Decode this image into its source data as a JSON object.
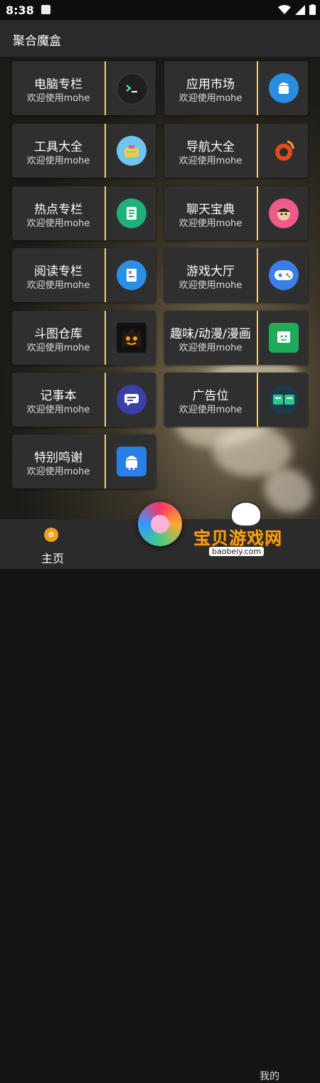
{
  "status_bar": {
    "time": "8:38"
  },
  "app": {
    "title": "聚合魔盒"
  },
  "cards": [
    {
      "title": "电脑专栏",
      "subtitle": "欢迎使用mohe",
      "icon": "terminal-icon"
    },
    {
      "title": "应用市场",
      "subtitle": "欢迎使用mohe",
      "icon": "android-icon"
    },
    {
      "title": "工具大全",
      "subtitle": "欢迎使用mohe",
      "icon": "toolbox-icon"
    },
    {
      "title": "导航大全",
      "subtitle": "欢迎使用mohe",
      "icon": "weibo-icon"
    },
    {
      "title": "热点专栏",
      "subtitle": "欢迎使用mohe",
      "icon": "document-icon"
    },
    {
      "title": "聊天宝典",
      "subtitle": "欢迎使用mohe",
      "icon": "face-icon"
    },
    {
      "title": "阅读专栏",
      "subtitle": "欢迎使用mohe",
      "icon": "book-icon"
    },
    {
      "title": "游戏大厅",
      "subtitle": "欢迎使用mohe",
      "icon": "gamepad-icon"
    },
    {
      "title": "斗图仓库",
      "subtitle": "欢迎使用mohe",
      "icon": "monster-icon"
    },
    {
      "title": "趣味/动漫/漫画",
      "subtitle": "欢迎使用mohe",
      "icon": "smiley-chat-icon"
    },
    {
      "title": "记事本",
      "subtitle": "欢迎使用mohe",
      "icon": "message-icon"
    },
    {
      "title": "广告位",
      "subtitle": "欢迎使用mohe",
      "icon": "ad-icon"
    },
    {
      "title": "特别鸣谢",
      "subtitle": "欢迎使用mohe",
      "icon": "android-box-icon"
    }
  ],
  "bottom_nav": {
    "home_label": "主页",
    "profile_label": "我的"
  },
  "watermark": {
    "text": "宝贝游戏网",
    "url": "baobeiy.com"
  }
}
